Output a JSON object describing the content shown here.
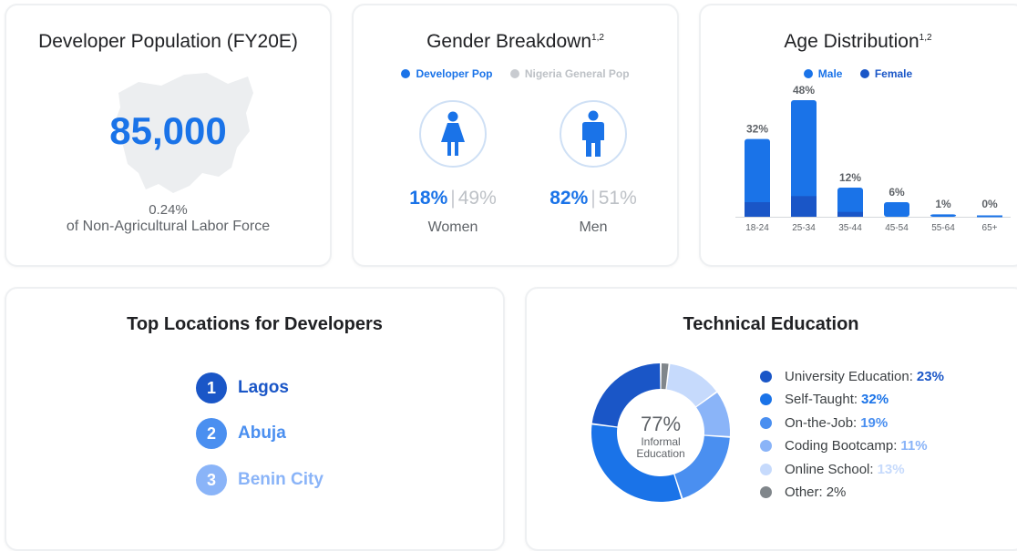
{
  "colors": {
    "blue_dark": "#1a56c7",
    "blue": "#1a73e8",
    "blue_mid": "#4a8ff0",
    "blue_light": "#8ab4f8",
    "blue_pale": "#c6dafc",
    "gray": "#80868b",
    "gray_light": "#bdc1c6"
  },
  "population": {
    "title": "Developer Population (FY20E)",
    "value": "85,000",
    "share": "0.24%",
    "caption": "of Non-Agricultural Labor Force"
  },
  "gender": {
    "title": "Gender Breakdown",
    "title_sup": "1,2",
    "legend_dev": "Developer Pop",
    "legend_general": "Nigeria General Pop",
    "women_dev": "18%",
    "women_general": "49%",
    "women_label": "Women",
    "men_dev": "82%",
    "men_general": "51%",
    "men_label": "Men"
  },
  "age": {
    "title_sup": "1,2"
  },
  "locations": {
    "title": "Top Locations for Developers",
    "items": [
      {
        "rank": "1",
        "name": "Lagos"
      },
      {
        "rank": "2",
        "name": "Abuja"
      },
      {
        "rank": "3",
        "name": "Benin City"
      }
    ]
  },
  "education": {
    "center_value": "77%",
    "center_line1": "Informal",
    "center_line2": "Education"
  },
  "chart_data": [
    {
      "type": "bar",
      "title": "Age Distribution",
      "categories": [
        "18-24",
        "25-34",
        "35-44",
        "45-54",
        "55-64",
        "65+"
      ],
      "data_labels": [
        "32%",
        "48%",
        "12%",
        "6%",
        "1%",
        "0%"
      ],
      "series": [
        {
          "name": "Male",
          "values": [
            32,
            48,
            12,
            6,
            1,
            0
          ]
        },
        {
          "name": "Female",
          "values": [
            6,
            8.5,
            2,
            0,
            0,
            0
          ]
        }
      ],
      "legend": "top-center",
      "ylim": [
        0,
        48
      ]
    },
    {
      "type": "pie",
      "title": "Technical Education",
      "labels": [
        "University Education",
        "Self-Taught",
        "On-the-Job",
        "Coding Bootcamp",
        "Online School",
        "Other"
      ],
      "value_labels": [
        "23%",
        "32%",
        "19%",
        "11%",
        "13%",
        "2%"
      ],
      "values": [
        23,
        32,
        19,
        11,
        13,
        2
      ],
      "colors": [
        "#1a56c7",
        "#1a73e8",
        "#4a8ff0",
        "#8ab4f8",
        "#c6dafc",
        "#80868b"
      ],
      "legend": "right"
    }
  ]
}
